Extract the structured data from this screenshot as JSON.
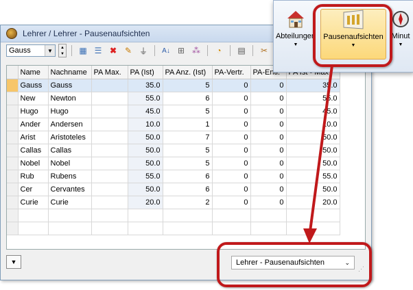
{
  "window": {
    "title": "Lehrer / Lehrer - Pausenaufsichten"
  },
  "toolbar": {
    "selector_value": "Gauss"
  },
  "table": {
    "columns": [
      "Name",
      "Nachname",
      "PA Max.",
      "PA (Ist)",
      "PA Anz. (Ist)",
      "PA-Vertr.",
      "PA-Entl.",
      "PA Ist - Max"
    ],
    "rows": [
      [
        "Gauss",
        "Gauss",
        "",
        "35.0",
        "5",
        "0",
        "0",
        "35.0"
      ],
      [
        "New",
        "Newton",
        "",
        "55.0",
        "6",
        "0",
        "0",
        "55.0"
      ],
      [
        "Hugo",
        "Hugo",
        "",
        "45.0",
        "5",
        "0",
        "0",
        "45.0"
      ],
      [
        "Ander",
        "Andersen",
        "",
        "10.0",
        "1",
        "0",
        "0",
        "10.0"
      ],
      [
        "Arist",
        "Aristoteles",
        "",
        "50.0",
        "7",
        "0",
        "0",
        "50.0"
      ],
      [
        "Callas",
        "Callas",
        "",
        "50.0",
        "5",
        "0",
        "0",
        "50.0"
      ],
      [
        "Nobel",
        "Nobel",
        "",
        "50.0",
        "5",
        "0",
        "0",
        "50.0"
      ],
      [
        "Rub",
        "Rubens",
        "",
        "55.0",
        "6",
        "0",
        "0",
        "55.0"
      ],
      [
        "Cer",
        "Cervantes",
        "",
        "50.0",
        "6",
        "0",
        "0",
        "50.0"
      ],
      [
        "Curie",
        "Curie",
        "",
        "20.0",
        "2",
        "0",
        "0",
        "20.0"
      ]
    ]
  },
  "statusbar": {
    "view_selector": "Lehrer - Pausenaufsichten"
  },
  "ribbon": {
    "buttons": [
      {
        "label": "Abteilungen",
        "icon": "house-icon"
      },
      {
        "label": "Pausenaufsichten",
        "icon": "pausenaufsichten-icon"
      },
      {
        "label": "Minut",
        "icon": "compass-icon"
      }
    ]
  },
  "colors": {
    "callout": "#c0191b",
    "selected_row": "#dbe8f7"
  }
}
